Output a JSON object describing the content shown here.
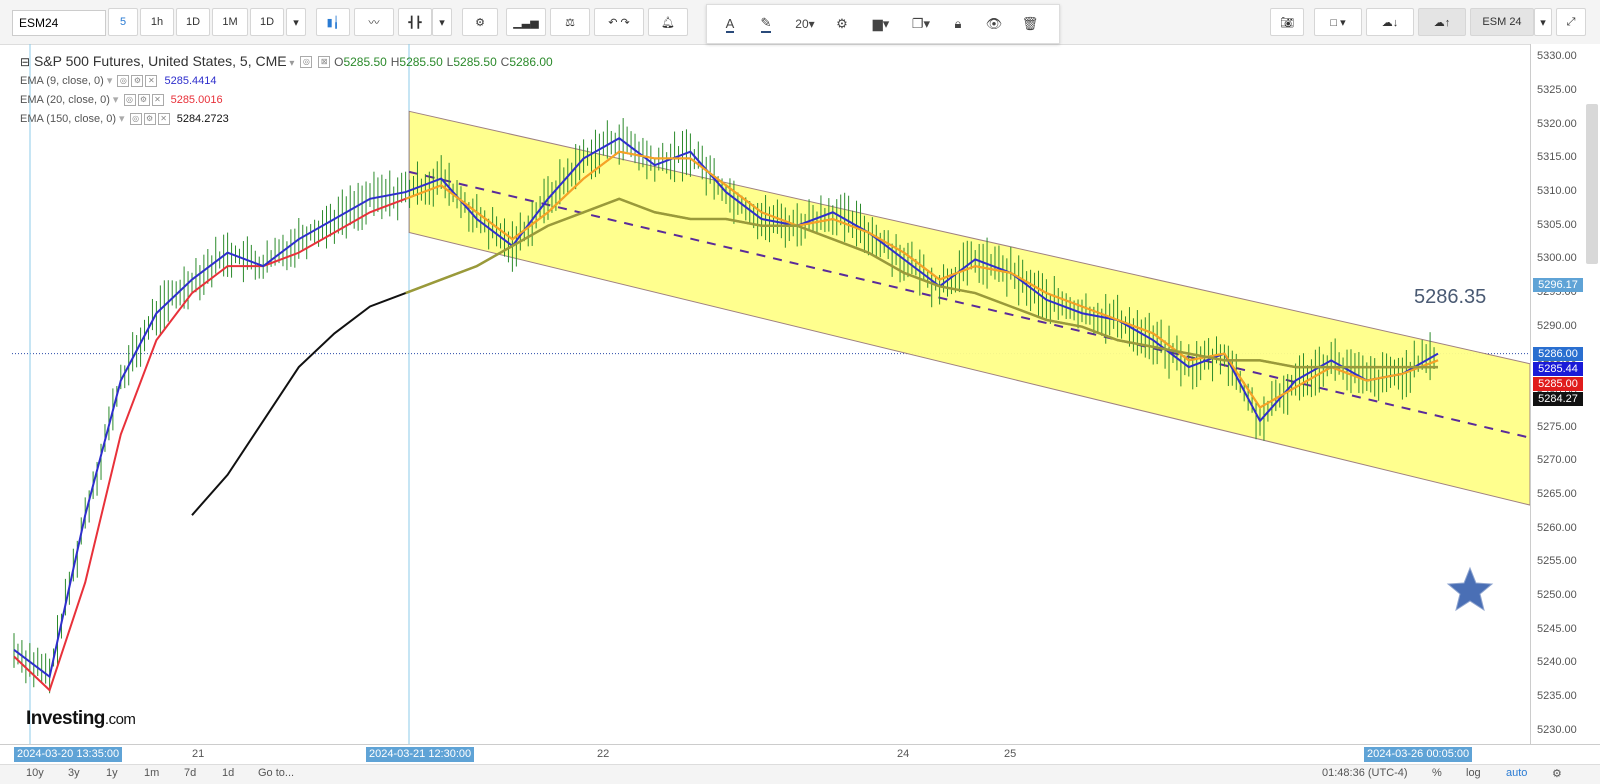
{
  "toolbar": {
    "symbol": "ESM24",
    "intervals": [
      "5",
      "1h",
      "1D",
      "1M",
      "1D"
    ],
    "active_interval": "5",
    "symbol_compare": "ESM 24",
    "font_size": "20"
  },
  "legend": {
    "title": "S&P 500 Futures, United States, 5, CME",
    "ohlc": {
      "o": "O",
      "o_val": "5285.50",
      "h": "H",
      "h_val": "5285.50",
      "l": "L",
      "l_val": "5285.50",
      "c": "C",
      "c_val": "5286.00"
    },
    "indicators": [
      {
        "label": "EMA (9, close, 0)",
        "value": "5285.4414",
        "color": "#2e2ecc"
      },
      {
        "label": "EMA (20, close, 0)",
        "value": "5285.0016",
        "color": "#e8313a"
      },
      {
        "label": "EMA (150, close, 0)",
        "value": "5284.2723",
        "color": "#111111"
      }
    ]
  },
  "overlay": {
    "big_price": "5286.35",
    "logo_main": "Investing",
    "logo_suffix": ".com"
  },
  "price_axis": {
    "ticks": [
      "5330.00",
      "5325.00",
      "5320.00",
      "5315.00",
      "5310.00",
      "5305.00",
      "5300.00",
      "5295.00",
      "5290.00",
      "5285.00",
      "5280.00",
      "5275.00",
      "5270.00",
      "5265.00",
      "5260.00",
      "5255.00",
      "5250.00",
      "5245.00",
      "5240.00",
      "5235.00",
      "5230.00"
    ],
    "labels": [
      {
        "text": "5296.17",
        "bg": "#5fa3d6",
        "price": 5296.17
      },
      {
        "text": "5286.00",
        "bg": "#2a6fd0",
        "price": 5286.0
      },
      {
        "text": "5285.44",
        "bg": "#1a1ad8",
        "price": 5285.44
      },
      {
        "text": "5285.00",
        "bg": "#e01c1c",
        "price": 5285.0
      },
      {
        "text": "5284.27",
        "bg": "#111111",
        "price": 5284.27
      }
    ]
  },
  "time_axis": {
    "ticks": [
      "21",
      "22",
      "24",
      "25"
    ],
    "cursor_labels": [
      "2024-03-20 13:35:00",
      "2024-03-21 12:30:00",
      "2024-03-26 00:05:00"
    ]
  },
  "bottom_bar": {
    "ranges": [
      "10y",
      "3y",
      "1y",
      "1m",
      "7d",
      "1d"
    ],
    "goto": "Go to...",
    "clock": "01:48:36 (UTC-4)",
    "percent": "%",
    "log": "log",
    "auto": "auto"
  },
  "chart_data": {
    "type": "line",
    "title": "S&P 500 Futures, United States, 5, CME",
    "xlabel": "",
    "ylabel": "",
    "ylim": [
      5228,
      5332
    ],
    "x_ticks": [
      "21",
      "22",
      "24",
      "25"
    ],
    "colors": {
      "price": "#2b8a2b",
      "ema9": "#2e2ecc",
      "ema20": "#e8313a",
      "ema150": "#111111",
      "ema_fast_in_channel": "#f5a623",
      "ema_slow_in_channel": "#9a9a3a",
      "channel_fill": "#ffff88",
      "median": "#5a2a9a"
    },
    "series": [
      {
        "name": "EMA (9, close, 0)",
        "t": [
          0,
          1,
          2,
          3,
          4,
          5,
          6,
          7,
          8,
          9,
          10,
          11,
          12,
          13,
          14,
          15,
          16,
          17,
          18,
          19,
          20,
          21,
          22,
          23,
          24,
          25,
          26,
          27,
          28,
          29,
          30,
          31,
          32,
          33,
          34,
          35,
          36,
          37,
          38,
          39,
          40
        ],
        "y": [
          5242,
          5238,
          5262,
          5282,
          5292,
          5297,
          5301,
          5299,
          5303,
          5306,
          5309,
          5310,
          5312,
          5306,
          5302,
          5309,
          5315,
          5318,
          5314,
          5316,
          5310,
          5306,
          5305,
          5307,
          5304,
          5300,
          5296,
          5300,
          5298,
          5294,
          5292,
          5291,
          5288,
          5284,
          5286,
          5276,
          5282,
          5285,
          5282,
          5283,
          5286
        ]
      },
      {
        "name": "EMA (20, close, 0)",
        "t": [
          0,
          1,
          2,
          3,
          4,
          5,
          6,
          7,
          8,
          9,
          10,
          11,
          12,
          13,
          14,
          15,
          16,
          17,
          18,
          19,
          20,
          21,
          22,
          23,
          24,
          25,
          26,
          27,
          28,
          29,
          30,
          31,
          32,
          33,
          34,
          35,
          36,
          37,
          38,
          39,
          40
        ],
        "y": [
          5241,
          5236,
          5252,
          5274,
          5288,
          5295,
          5299,
          5299,
          5301,
          5304,
          5307,
          5309,
          5311,
          5307,
          5303,
          5307,
          5312,
          5316,
          5315,
          5315,
          5311,
          5307,
          5305,
          5306,
          5304,
          5301,
          5297,
          5299,
          5298,
          5295,
          5293,
          5291,
          5289,
          5285,
          5286,
          5278,
          5281,
          5284,
          5282,
          5283,
          5285
        ]
      },
      {
        "name": "EMA (150, close, 0)",
        "t": [
          5,
          6,
          7,
          8,
          9,
          10,
          11,
          12,
          13,
          14,
          15,
          16,
          17,
          18,
          19,
          20,
          21,
          22,
          23,
          24,
          25,
          26,
          27,
          28,
          29,
          30,
          31,
          32,
          33,
          34,
          35,
          36,
          37,
          38,
          39,
          40
        ],
        "y": [
          5262,
          5268,
          5276,
          5284,
          5289,
          5293,
          5295,
          5297,
          5299,
          5302,
          5305,
          5307,
          5309,
          5307,
          5306,
          5306,
          5305,
          5305,
          5303,
          5301,
          5298,
          5296,
          5295,
          5293,
          5291,
          5290,
          5288,
          5287,
          5286,
          5285,
          5285,
          5284,
          5284,
          5284,
          5284,
          5284
        ]
      }
    ],
    "channel": {
      "upper": [
        5322,
        5287
      ],
      "lower": [
        5304,
        5266
      ],
      "median": [
        5313,
        5276
      ]
    }
  }
}
